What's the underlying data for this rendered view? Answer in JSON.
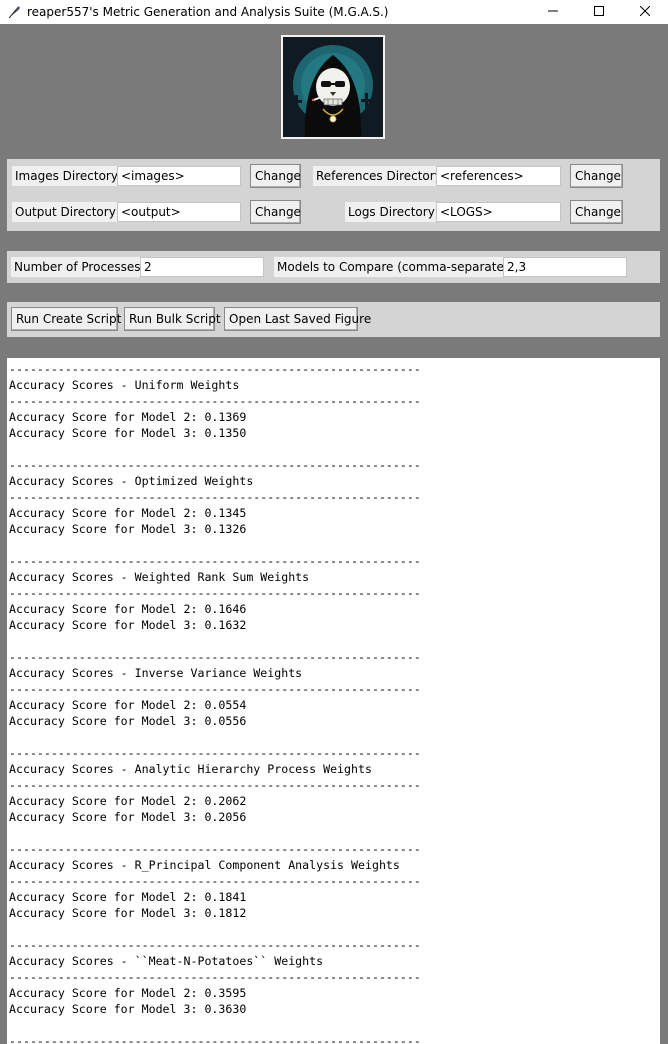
{
  "window": {
    "title": "reaper557's Metric Generation and Analysis Suite (M.G.A.S.)"
  },
  "directories": {
    "images": {
      "label": "Images Directory",
      "value": "<images>",
      "button": "Change"
    },
    "references": {
      "label": "References Directory",
      "value": "<references>",
      "button": "Change"
    },
    "output": {
      "label": "Output Directory",
      "value": "<output>",
      "button": "Change"
    },
    "logs": {
      "label": "Logs Directory",
      "value": "<LOGS>",
      "button": "Change"
    }
  },
  "options": {
    "processes": {
      "label": "Number of Processes",
      "value": "2"
    },
    "models": {
      "label": "Models to Compare (comma-separated)",
      "value": "2,3"
    }
  },
  "actions": {
    "create_script": "Run Create Script",
    "bulk_script": "Run Bulk Script",
    "open_figure": "Open Last Saved Figure"
  },
  "output_lines": [
    "-----------------------------------------------------------",
    "Accuracy Scores - Uniform Weights",
    "-----------------------------------------------------------",
    "Accuracy Score for Model 2: 0.1369",
    "Accuracy Score for Model 3: 0.1350",
    "",
    "-----------------------------------------------------------",
    "Accuracy Scores - Optimized Weights",
    "-----------------------------------------------------------",
    "Accuracy Score for Model 2: 0.1345",
    "Accuracy Score for Model 3: 0.1326",
    "",
    "-----------------------------------------------------------",
    "Accuracy Scores - Weighted Rank Sum Weights",
    "-----------------------------------------------------------",
    "Accuracy Score for Model 2: 0.1646",
    "Accuracy Score for Model 3: 0.1632",
    "",
    "-----------------------------------------------------------",
    "Accuracy Scores - Inverse Variance Weights",
    "-----------------------------------------------------------",
    "Accuracy Score for Model 2: 0.0554",
    "Accuracy Score for Model 3: 0.0556",
    "",
    "-----------------------------------------------------------",
    "Accuracy Scores - Analytic Hierarchy Process Weights",
    "-----------------------------------------------------------",
    "Accuracy Score for Model 2: 0.2062",
    "Accuracy Score for Model 3: 0.2056",
    "",
    "-----------------------------------------------------------",
    "Accuracy Scores - R_Principal Component Analysis Weights",
    "-----------------------------------------------------------",
    "Accuracy Score for Model 2: 0.1841",
    "Accuracy Score for Model 3: 0.1812",
    "",
    "-----------------------------------------------------------",
    "Accuracy Scores - ``Meat-N-Potatoes`` Weights",
    "-----------------------------------------------------------",
    "Accuracy Score for Model 2: 0.3595",
    "Accuracy Score for Model 3: 0.3630",
    "",
    "-----------------------------------------------------------"
  ],
  "icons": {
    "app": "feather-icon",
    "minimize": "minimize-icon",
    "maximize": "maximize-icon",
    "close": "close-icon",
    "logo": "grim-reaper-logo"
  },
  "colors": {
    "window_bg": "#7a7a7a",
    "panel_bg": "#d4d4d4",
    "logo_bg": "#0f1a22",
    "logo_accent": "#1f6f7a"
  }
}
